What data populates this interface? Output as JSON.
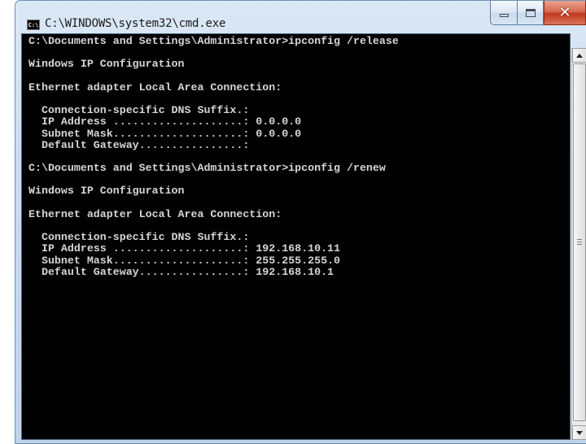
{
  "window": {
    "title": "C:\\WINDOWS\\system32\\cmd.exe",
    "icon_text": "C:\\",
    "icon": "command-prompt-icon"
  },
  "caption_buttons": {
    "minimize": "minimize-icon",
    "maximize": "maximize-icon",
    "close_label": "✕"
  },
  "console": {
    "lines": [
      "C:\\Documents and Settings\\Administrator>ipconfig /release",
      "",
      "Windows IP Configuration",
      "",
      "Ethernet adapter Local Area Connection:",
      "",
      "  Connection-specific DNS Suffix.:",
      "  IP Address ....................: 0.0.0.0",
      "  Subnet Mask....................: 0.0.0.0",
      "  Default Gateway................:",
      "",
      "C:\\Documents and Settings\\Administrator>ipconfig /renew",
      "",
      "Windows IP Configuration",
      "",
      "Ethernet adapter Local Area Connection:",
      "",
      "  Connection-specific DNS Suffix.:",
      "  IP Address ....................: 192.168.10.11",
      "  Subnet Mask....................: 255.255.255.0",
      "  Default Gateway................: 192.168.10.1"
    ]
  },
  "colors": {
    "console_bg": "#000000",
    "console_text": "#d6d6d6",
    "close_button": "#c1391d"
  }
}
